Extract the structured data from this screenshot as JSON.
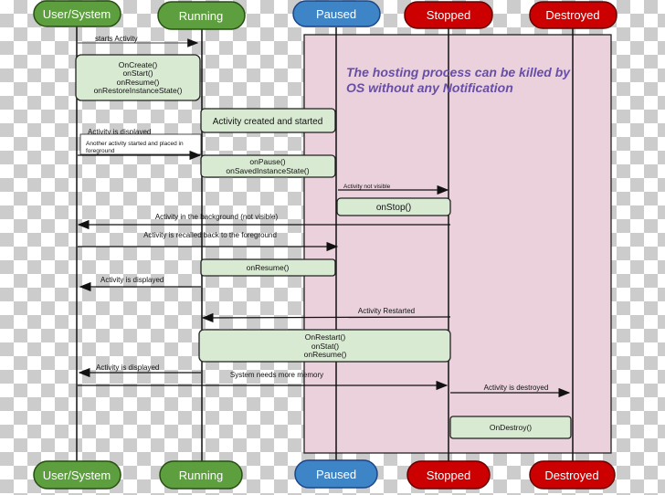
{
  "actors": [
    "User/System",
    "Running",
    "Paused",
    "Stopped",
    "Destroyed"
  ],
  "colors": {
    "green": "#5d9e3f",
    "blue": "#3d85c6",
    "red": "#cc0000",
    "pink_area": "#ead1dc",
    "box": "#d9ead3",
    "note": "#674ea7"
  },
  "note": [
    "The hosting process can be killed by",
    "OS without any Notification"
  ],
  "messages": {
    "starts": "starts Activity",
    "displayed1": "Activity is displayed",
    "another": [
      "Another activity started and placed in",
      "foreground"
    ],
    "not_visible": "Activity not visible",
    "background": "Activity in the background (not visible)",
    "recalled": "Activity is recalled back to the foreground",
    "displayed2": "Activity is displayed",
    "restarted": "Activity Restarted",
    "displayed3": "Activity is displayed",
    "memory": "System needs more memory",
    "destroyed": "Activity is destroyed"
  },
  "boxes": {
    "create": [
      "OnCreate()",
      "onStart()",
      "onResume()",
      "onRestoreInstanceState()"
    ],
    "created": "Activity created and started",
    "pause": [
      "onPause()",
      "onSavedInstanceState()"
    ],
    "stop": "onStop()",
    "resume": "onResume()",
    "restart": [
      "OnRestart()",
      "onStat()",
      "onResume()"
    ],
    "destroy": "OnDestroy()"
  }
}
